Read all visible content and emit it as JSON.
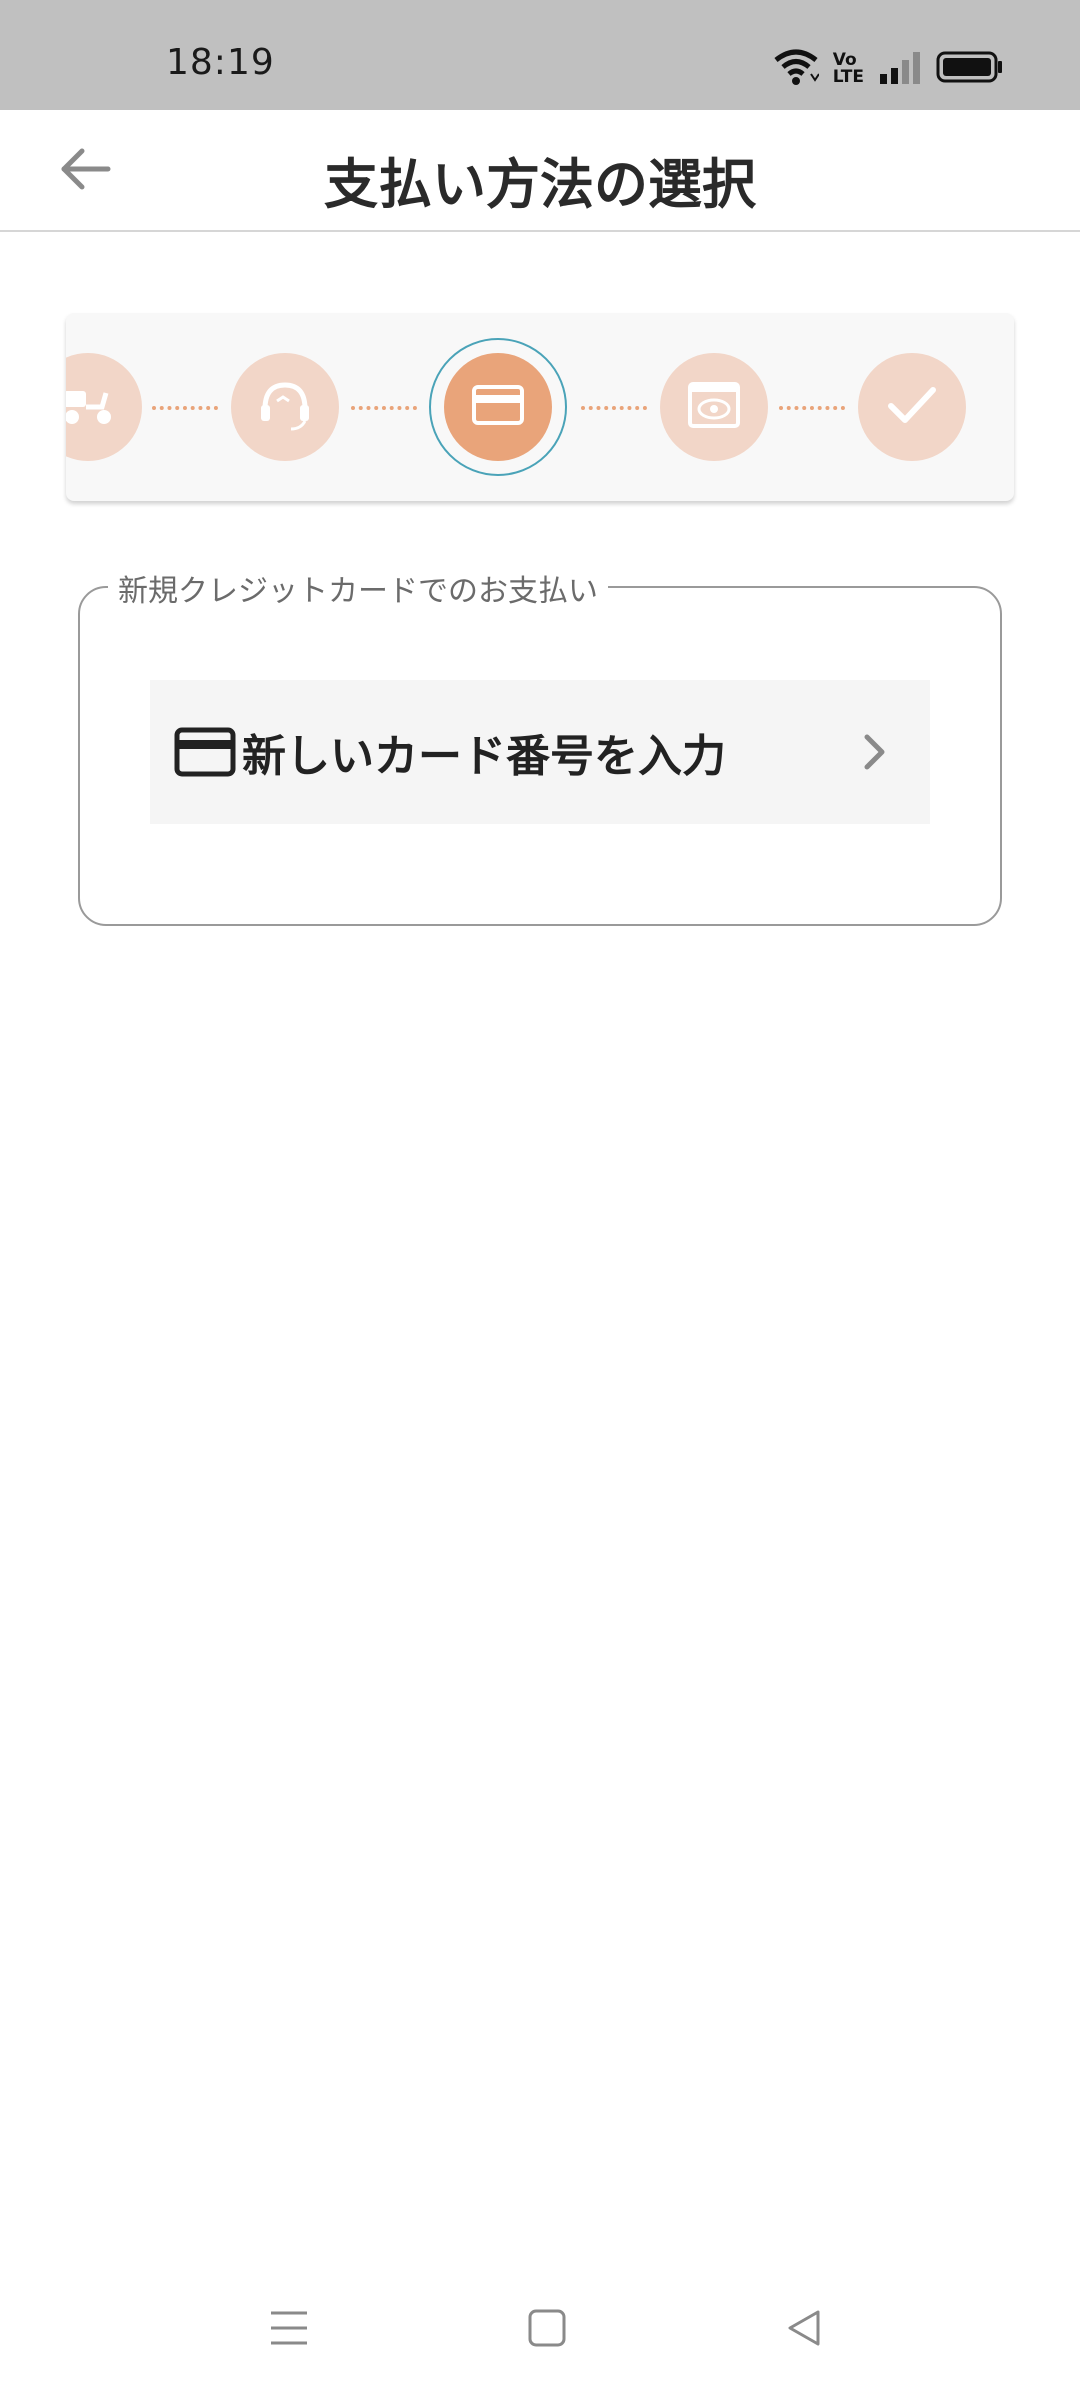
{
  "status_bar": {
    "time": "18:19",
    "icons": [
      "wifi-icon",
      "volte-icon",
      "signal-icon",
      "battery-icon"
    ],
    "volte_text_top": "Vo",
    "volte_text_bottom": "LTE"
  },
  "app_bar": {
    "title": "支払い方法の選択",
    "back_icon": "arrow-left-icon"
  },
  "stepper": {
    "steps": [
      {
        "icon": "delivery-scooter-icon",
        "state": "done"
      },
      {
        "icon": "support-headset-icon",
        "state": "done"
      },
      {
        "icon": "credit-card-icon",
        "state": "active"
      },
      {
        "icon": "review-eye-icon",
        "state": "pending"
      },
      {
        "icon": "check-icon",
        "state": "pending"
      }
    ],
    "colors": {
      "inactive": "#f2d6c8",
      "active": "#e9a47a",
      "ring": "#4aa3b8",
      "dots": "#e9a47a"
    }
  },
  "payment": {
    "group_label": "新規クレジットカードでのお支払い",
    "new_card_label": "新しいカード番号を入力",
    "new_card_icon": "credit-card-icon",
    "chevron_icon": "chevron-right-icon"
  },
  "nav_bar": {
    "icons": [
      "menu-icon",
      "home-icon",
      "back-triangle-icon"
    ]
  }
}
